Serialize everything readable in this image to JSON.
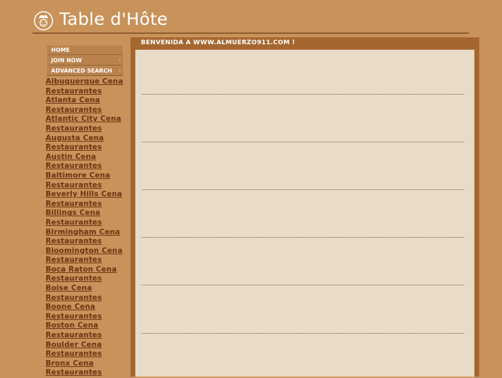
{
  "header": {
    "logo_text": "Table d'Hôte",
    "logo_icon": "chef-face-icon"
  },
  "nav": {
    "items": [
      {
        "label": "HOME"
      },
      {
        "label": "JOIN NOW"
      },
      {
        "label": "ADVANCED SEARCH"
      }
    ],
    "arrow_glyph": "›"
  },
  "cities": [
    {
      "l1": "Albuquerque Cena",
      "l2": "Restaurantes"
    },
    {
      "l1": "Atlanta Cena",
      "l2": "Restaurantes"
    },
    {
      "l1": "Atlantic City Cena",
      "l2": "Restaurantes"
    },
    {
      "l1": "Augusta Cena",
      "l2": "Restaurantes"
    },
    {
      "l1": "Austin Cena",
      "l2": "Restaurantes"
    },
    {
      "l1": "Baltimore Cena",
      "l2": "Restaurantes"
    },
    {
      "l1": "Beverly Hills Cena",
      "l2": "Restaurantes"
    },
    {
      "l1": "Billings Cena",
      "l2": "Restaurantes"
    },
    {
      "l1": "Birmingham Cena",
      "l2": "Restaurantes"
    },
    {
      "l1": "Bloomington Cena",
      "l2": "Restaurantes"
    },
    {
      "l1": "Boca Raton Cena",
      "l2": "Restaurantes"
    },
    {
      "l1": "Boise Cena",
      "l2": "Restaurantes"
    },
    {
      "l1": "Boone Cena",
      "l2": "Restaurantes"
    },
    {
      "l1": "Boston Cena",
      "l2": "Restaurantes"
    },
    {
      "l1": "Boulder Cena",
      "l2": "Restaurantes"
    },
    {
      "l1": "Bronx Cena",
      "l2": "Restaurantes"
    }
  ],
  "panel": {
    "title": "BENVENIDA A WWW.ALMUERZO911.COM !"
  },
  "colors": {
    "page_bg": "#c8925a",
    "panel_frame": "#a5672f",
    "panel_body": "#e8dcc8",
    "link": "#6b3412"
  }
}
